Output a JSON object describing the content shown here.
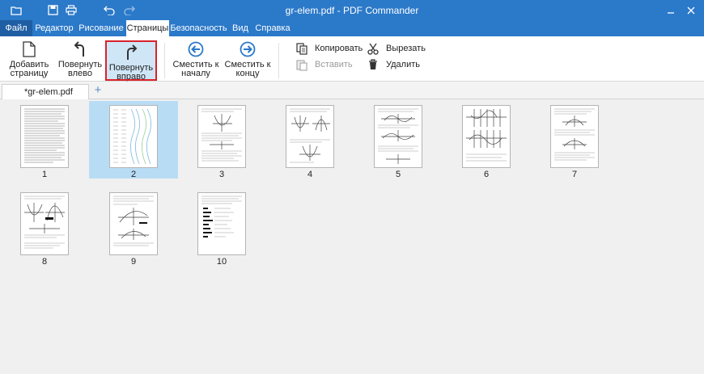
{
  "app": {
    "title": "gr-elem.pdf - PDF Commander"
  },
  "menu": {
    "file_label": "Файл",
    "tabs": [
      {
        "label": "Редактор"
      },
      {
        "label": "Рисование"
      },
      {
        "label": "Страницы"
      },
      {
        "label": "Безопасность"
      },
      {
        "label": "Вид"
      },
      {
        "label": "Справка"
      }
    ]
  },
  "ribbon": {
    "add_page": "Добавить\nстраницу",
    "rotate_left": "Повернуть\nвлево",
    "rotate_right": "Повернуть\nвправо",
    "move_start": "Сместить к\nначалу",
    "move_end": "Сместить к\nконцу",
    "copy": "Копировать",
    "paste": "Вставить",
    "cut": "Вырезать",
    "delete": "Удалить"
  },
  "document_tab": {
    "label": "*gr-elem.pdf"
  },
  "pages": [
    {
      "number": "1"
    },
    {
      "number": "2"
    },
    {
      "number": "3"
    },
    {
      "number": "4"
    },
    {
      "number": "5"
    },
    {
      "number": "6"
    },
    {
      "number": "7"
    },
    {
      "number": "8"
    },
    {
      "number": "9"
    },
    {
      "number": "10"
    }
  ],
  "selected_page": "2",
  "colors": {
    "titlebar": "#2b79c9",
    "file_tab": "#1f5ea3",
    "selection": "#b9dcf5",
    "highlight_outline": "#d8232a",
    "arrow_blue": "#2b79c9"
  }
}
